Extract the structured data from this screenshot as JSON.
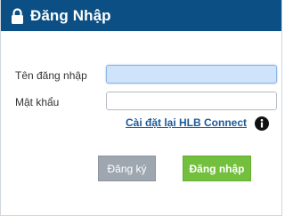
{
  "dialog": {
    "title": "Đăng Nhập",
    "title_icon": "lock-icon",
    "header_color": "#0b4f84"
  },
  "form": {
    "username_label": "Tên đăng nhập",
    "username_value": "",
    "password_label": "Mật khẩu",
    "password_value": "",
    "reset_link_text": "Cài đặt lại HLB Connect",
    "info_icon": "info-icon"
  },
  "buttons": {
    "register_label": "Đăng ký",
    "register_color": "#9ea7b0",
    "login_label": "Đăng nhập",
    "login_color": "#73bf3e"
  }
}
